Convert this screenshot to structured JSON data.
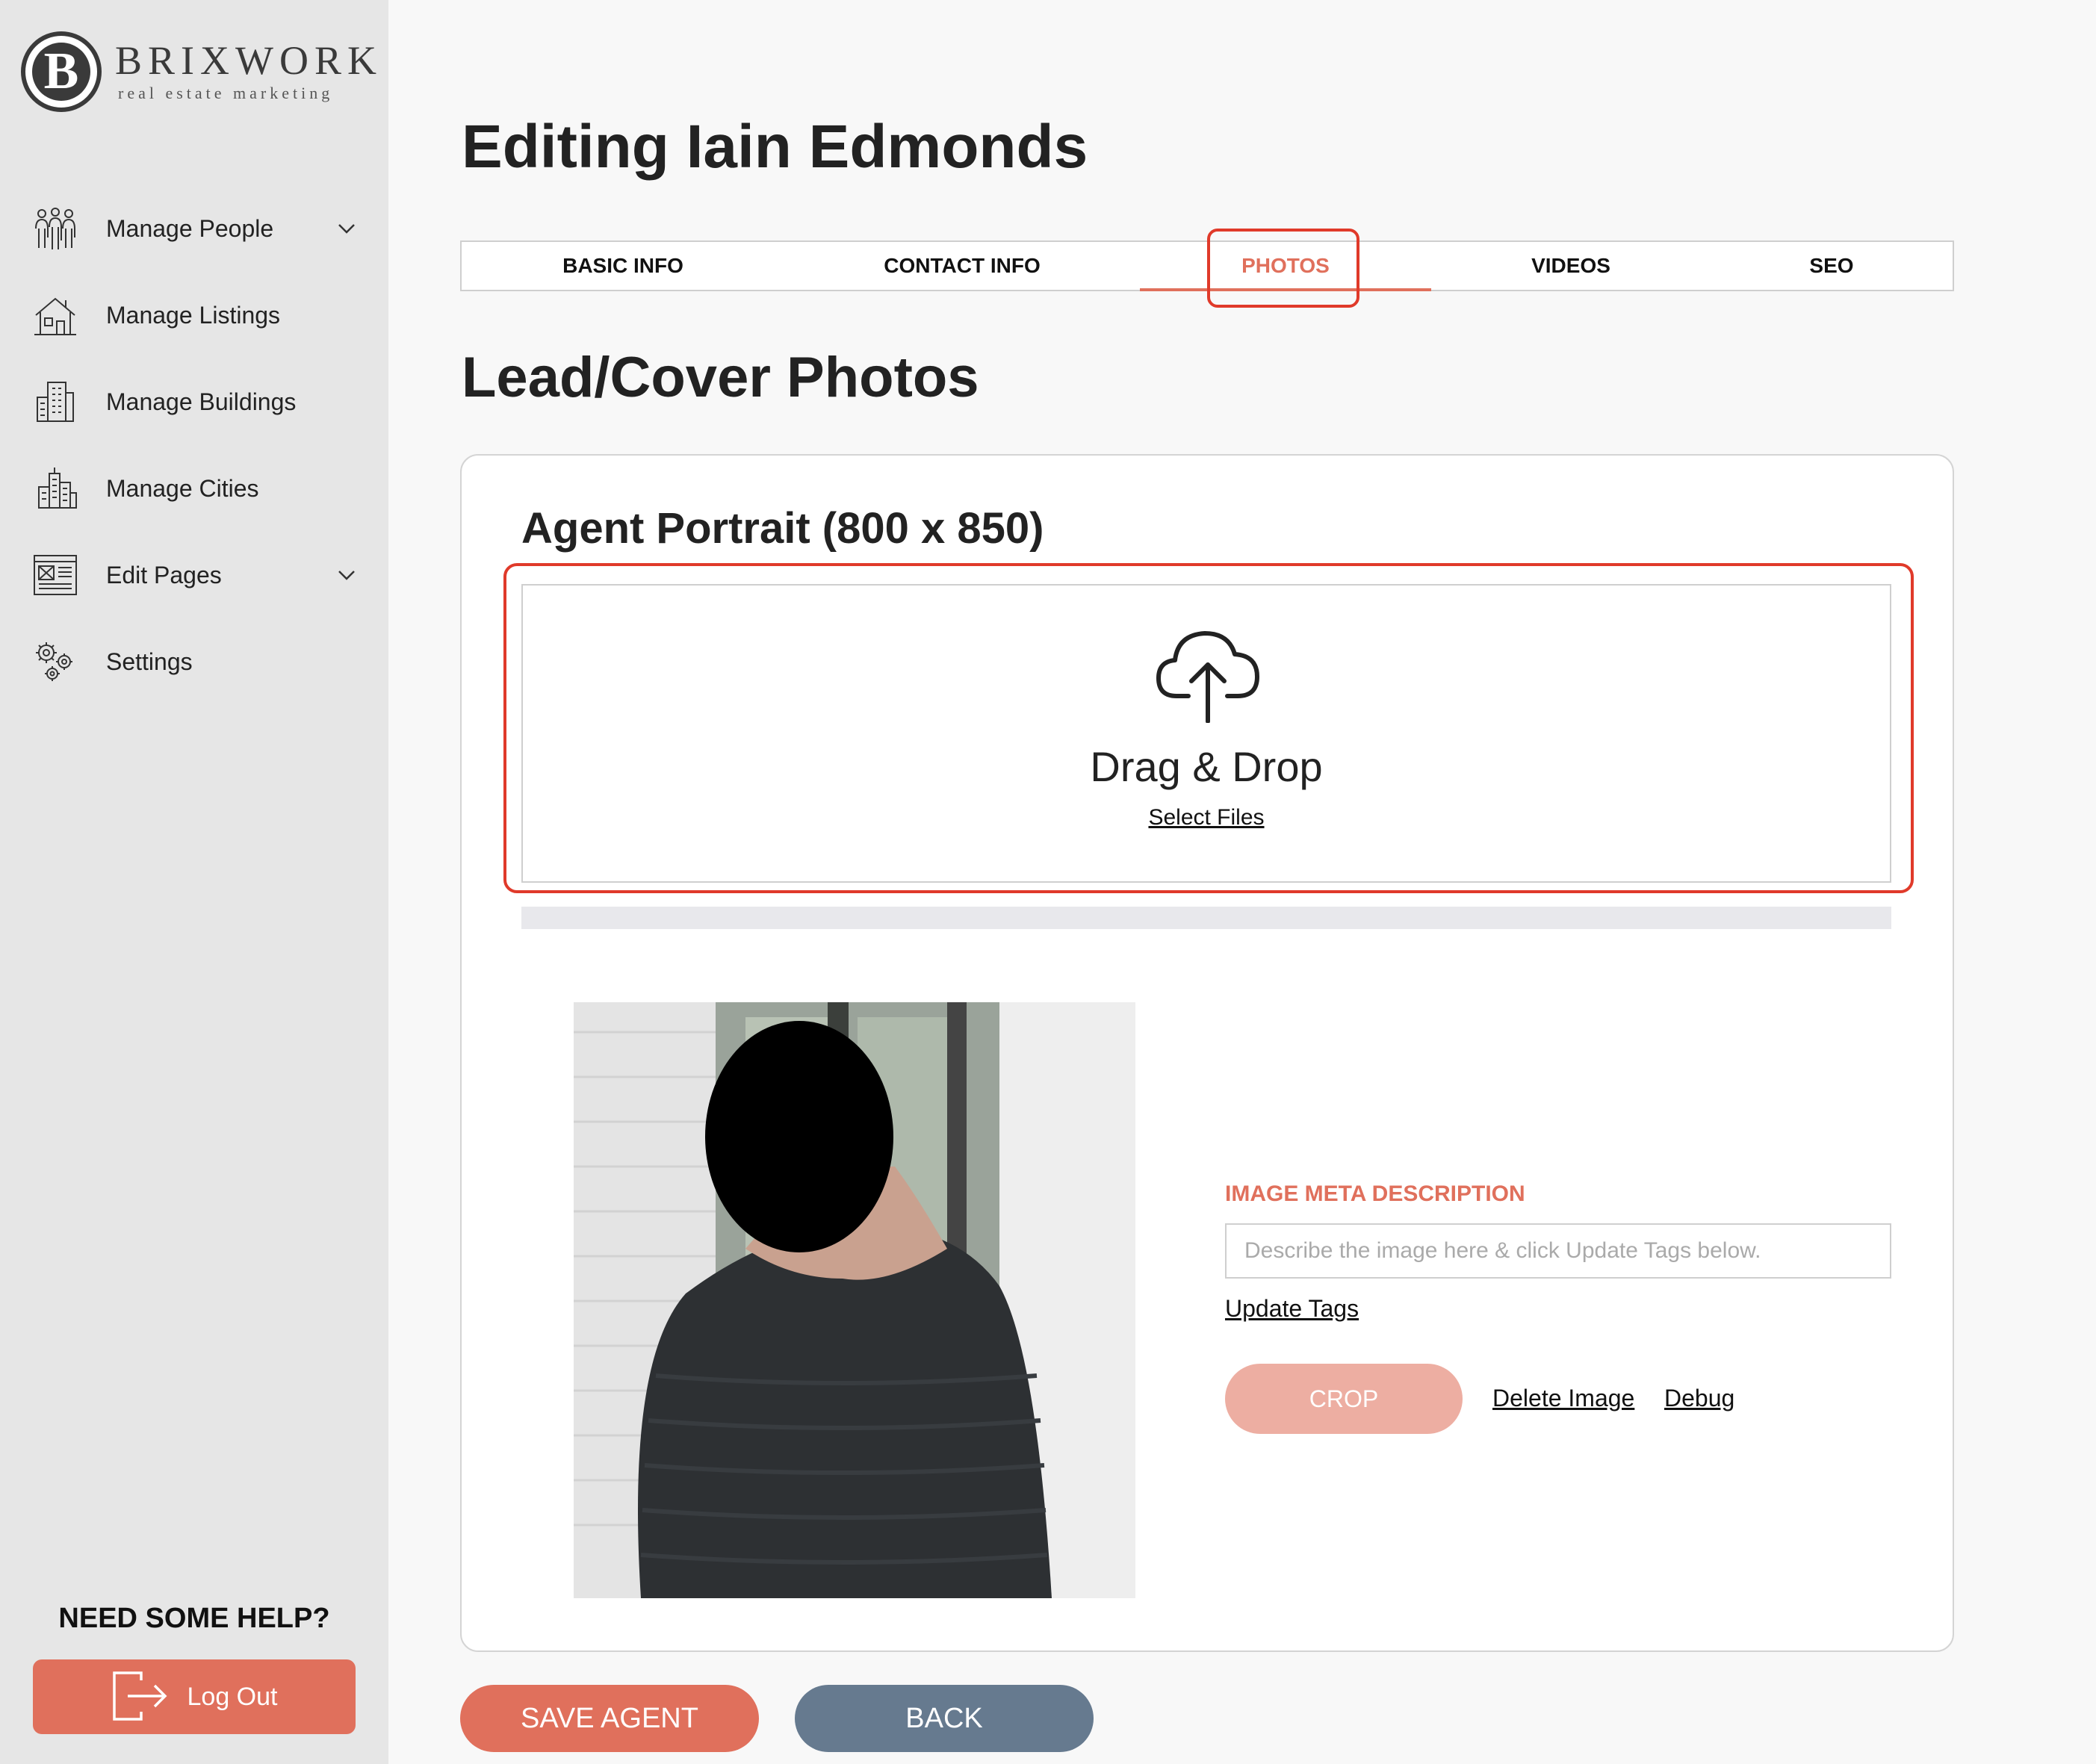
{
  "brand": {
    "name": "BRIXWORK",
    "tagline": "real estate marketing",
    "monogram": "B"
  },
  "sidebar": {
    "items": [
      {
        "label": "Manage People",
        "icon": "people-icon",
        "has_submenu": true
      },
      {
        "label": "Manage Listings",
        "icon": "house-icon",
        "has_submenu": false
      },
      {
        "label": "Manage Buildings",
        "icon": "building-icon",
        "has_submenu": false
      },
      {
        "label": "Manage Cities",
        "icon": "city-icon",
        "has_submenu": false
      },
      {
        "label": "Edit Pages",
        "icon": "page-layout-icon",
        "has_submenu": true
      },
      {
        "label": "Settings",
        "icon": "gears-icon",
        "has_submenu": false
      }
    ],
    "help_title": "NEED SOME HELP?",
    "logout_label": "Log Out"
  },
  "main": {
    "title": "Editing Iain Edmonds",
    "tabs": [
      {
        "label": "BASIC INFO",
        "active": false
      },
      {
        "label": "CONTACT INFO",
        "active": false
      },
      {
        "label": "PHOTOS",
        "active": true
      },
      {
        "label": "VIDEOS",
        "active": false
      },
      {
        "label": "SEO",
        "active": false
      }
    ],
    "section_title": "Lead/Cover Photos",
    "portrait": {
      "title": "Agent Portrait (800 x 850)",
      "drop_text": "Drag & Drop",
      "select_files": "Select Files"
    },
    "meta": {
      "label": "IMAGE META DESCRIPTION",
      "placeholder": "Describe the image here & click Update Tags below.",
      "value": "",
      "update_tags": "Update Tags"
    },
    "actions": {
      "crop": "CROP",
      "delete": "Delete Image",
      "debug": "Debug"
    },
    "footer": {
      "save": "SAVE AGENT",
      "back": "BACK"
    }
  },
  "colors": {
    "accent": "#e0705c",
    "accent_light": "#edaea2",
    "highlight": "#e03a2a",
    "back_button": "#667a8f",
    "sidebar_bg": "#e6e6e6"
  }
}
